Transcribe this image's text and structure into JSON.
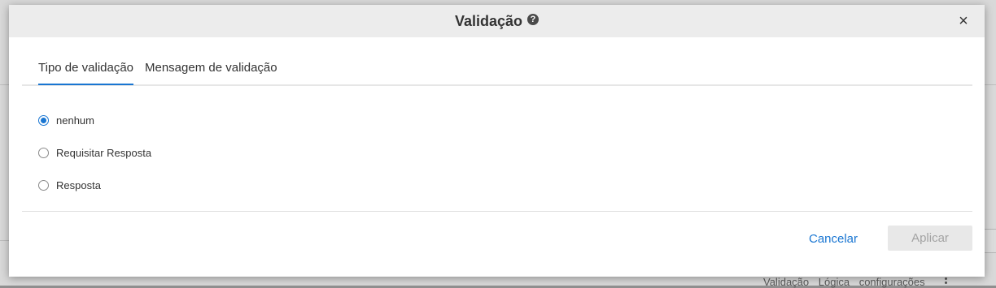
{
  "dialog": {
    "title": "Validação",
    "help_icon": "question-circle-icon",
    "close_symbol": "×"
  },
  "tabs": [
    {
      "label": "Tipo de validação",
      "active": true
    },
    {
      "label": "Mensagem de validação",
      "active": false
    }
  ],
  "validation_options": [
    {
      "label": "nenhum",
      "checked": true
    },
    {
      "label": "Requisitar Resposta",
      "checked": false
    },
    {
      "label": "Resposta",
      "checked": false
    }
  ],
  "footer": {
    "cancel_label": "Cancelar",
    "apply_label": "Aplicar"
  },
  "background": {
    "bottom_links": [
      "Validação",
      "Lógica",
      "configurações"
    ]
  },
  "colors": {
    "accent": "#1976d2",
    "header_bg": "#ececec",
    "disabled_button_bg": "#e8e8e8"
  }
}
